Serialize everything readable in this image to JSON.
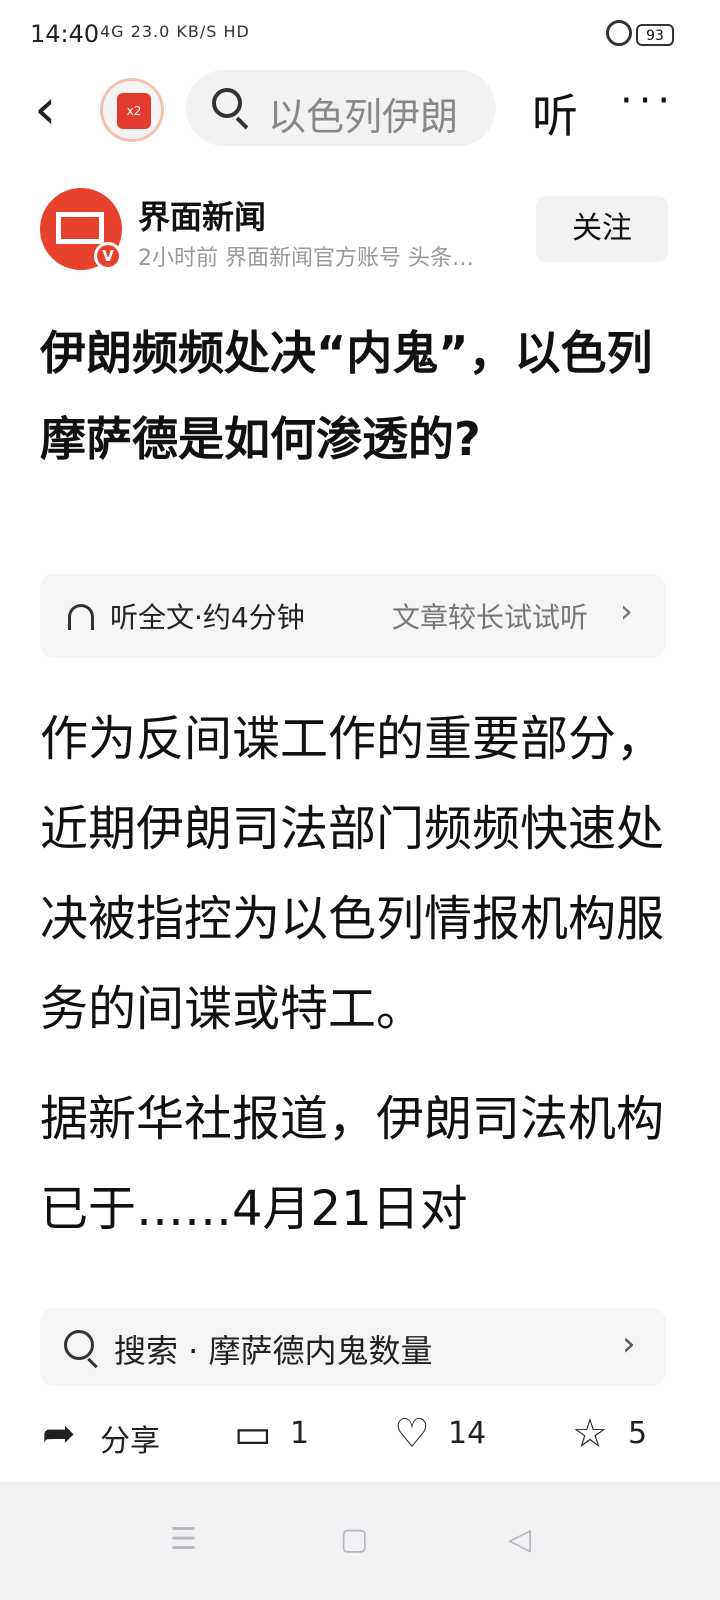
{
  "status": {
    "time": "14:40",
    "network": "4G  23.0 KB/S  HD",
    "battery": "93"
  },
  "topbar": {
    "search_placeholder": "以色列伊朗",
    "listen_label": "听",
    "more_label": "···",
    "redpack_label": "x2"
  },
  "author": {
    "name": "界面新闻",
    "meta": "2小时前  界面新闻官方账号 头条…",
    "follow_label": "关注"
  },
  "article": {
    "title": "伊朗频频处决“内鬼”，以色列摩萨德是如何渗透的?",
    "listen_full": "听全文·约4分钟",
    "listen_tip": "文章较长试试听",
    "paragraphs": [
      "作为反间谍工作的重要部分，近期伊朗司法部门频频快速处决被指控为以色列情报机构服务的间谍或特工。",
      "据新华社报道，伊朗司法机构已于……4月21日对"
    ]
  },
  "suggest": {
    "text": "搜索 · 摩萨德内鬼数量"
  },
  "actions": {
    "share": "分享",
    "comments": "1",
    "likes": "14",
    "favorites": "5"
  },
  "icons": [
    "back-icon",
    "search-icon",
    "redpack-icon",
    "more-icon",
    "headphones-icon",
    "chevron-right-icon",
    "share-icon",
    "comment-icon",
    "like-icon",
    "star-icon",
    "menu-icon",
    "home-icon",
    "nav-back-icon"
  ]
}
